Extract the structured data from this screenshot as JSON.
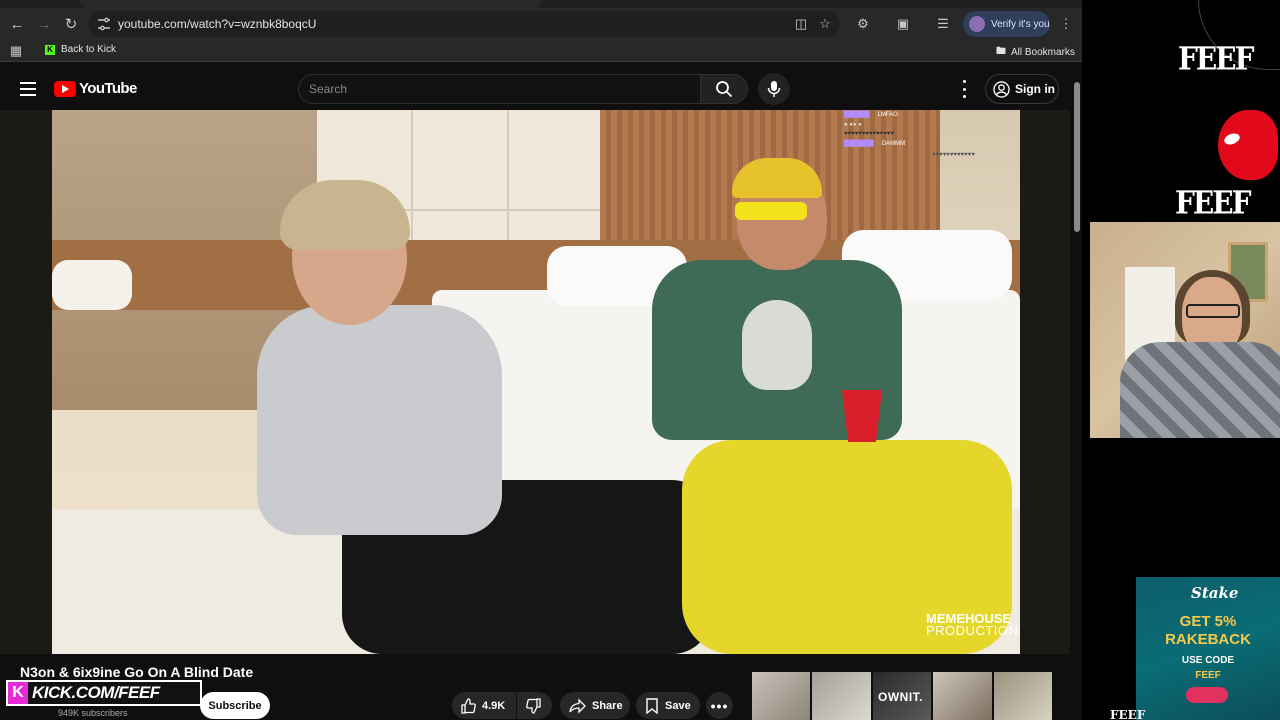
{
  "browser": {
    "url": "youtube.com/watch?v=wznbk8boqcU",
    "verify_label": "Verify it's you",
    "bookmark_kick": "Back to Kick",
    "bookmark_all": "All Bookmarks"
  },
  "youtube": {
    "logo_text": "YouTube",
    "search_placeholder": "Search",
    "signin_label": "Sign in"
  },
  "video": {
    "title": "N3on & 6ix9ine Go On A Blind Date",
    "subscribers": "949K subscribers",
    "subscribe_label": "Subscribe",
    "likes": "4.9K",
    "share_label": "Share",
    "save_label": "Save",
    "watermark_line1": "MEMEHOUSE",
    "watermark_line2": "PRODUCTIONS",
    "chat": [
      {
        "msg": "LMFAO"
      },
      {
        "msg": "DAMMM"
      }
    ],
    "rec_thumb_text": "OWNIT."
  },
  "overlay": {
    "kick_banner": "KICK.COM/FEEF",
    "kick_k": "K",
    "feef_logo_1": "FEEF",
    "feef_logo_2": "FEEF",
    "feef_bottom": "FEEF",
    "stake_logo": "Stake",
    "stake_line1": "GET 5%",
    "stake_line2": "RAKEBACK",
    "stake_use_code": "USE CODE",
    "stake_code": "FEEF"
  },
  "colors": {
    "yt_red": "#ff0000",
    "kick_green": "#53fc18",
    "kick_pink": "#e62ad8",
    "stake_teal": "#0a6c74",
    "stake_gold": "#f6c94a"
  }
}
